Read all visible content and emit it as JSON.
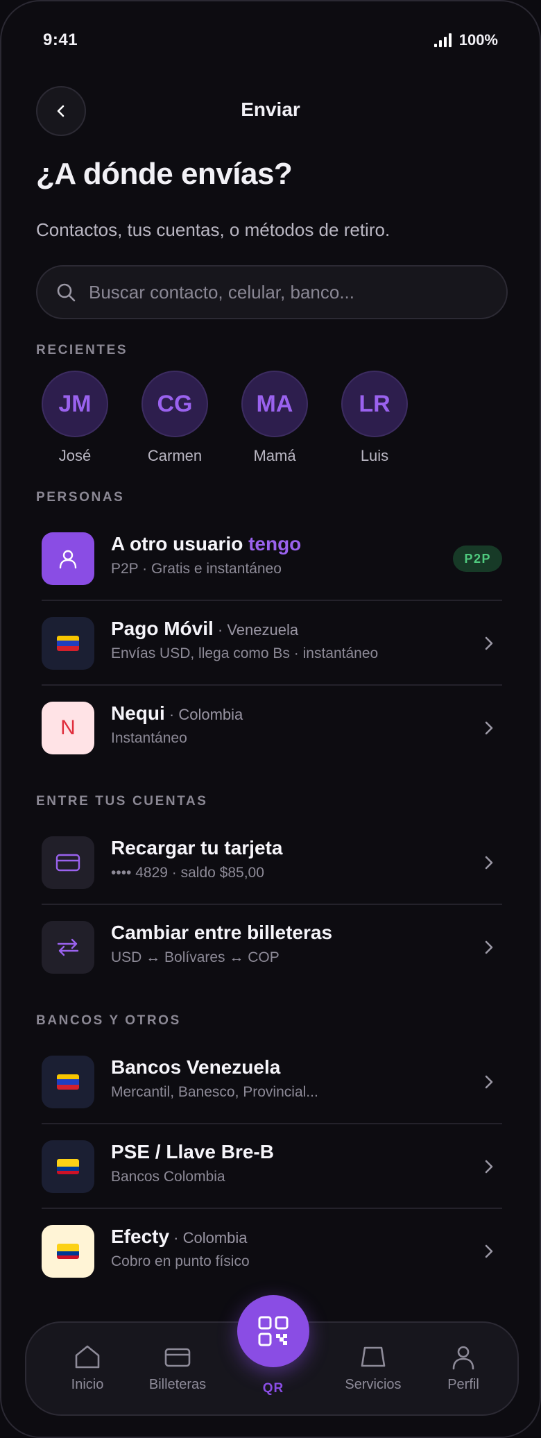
{
  "status": {
    "time": "9:41",
    "battery": "100%"
  },
  "header": {
    "title": "Enviar"
  },
  "heading": "¿A dónde envías?",
  "subheading": "Contactos, tus cuentas, o métodos de retiro.",
  "search": {
    "placeholder": "Buscar contacto, celular, banco..."
  },
  "sections": {
    "recientes": "RECIENTES",
    "personas": "PERSONAS",
    "entre_cuentas": "ENTRE TUS CUENTAS",
    "bancos": "BANCOS Y OTROS"
  },
  "recents": [
    {
      "initials": "JM",
      "name": "José"
    },
    {
      "initials": "CG",
      "name": "Carmen"
    },
    {
      "initials": "MA",
      "name": "Mamá"
    },
    {
      "initials": "LR",
      "name": "Luis"
    }
  ],
  "personas": [
    {
      "title": "A otro usuario ",
      "accent": "tengo",
      "country": "",
      "subtitle": "P2P · Gratis e instantáneo",
      "badge": "P2P"
    },
    {
      "title": "Pago Móvil",
      "country": " · Venezuela",
      "subtitle": "Envías USD, llega como Bs · instantáneo"
    },
    {
      "title": "Nequi",
      "country": " · Colombia",
      "subtitle": "Instantáneo",
      "letter": "N"
    }
  ],
  "cuentas": [
    {
      "title": "Recargar tu tarjeta",
      "subtitle": "•••• 4829 · saldo $85,00"
    },
    {
      "title": "Cambiar entre billeteras",
      "subtitle": "USD ↔ Bolívares ↔ COP"
    }
  ],
  "bancos": [
    {
      "title": "Bancos Venezuela",
      "country": "",
      "subtitle": "Mercantil, Banesco, Provincial..."
    },
    {
      "title": "PSE / Llave Bre-B",
      "country": "",
      "subtitle": "Bancos Colombia"
    },
    {
      "title": "Efecty",
      "country": " · Colombia",
      "subtitle": "Cobro en punto físico"
    }
  ],
  "tabs": {
    "inicio": "Inicio",
    "billeteras": "Billeteras",
    "qr": "QR",
    "servicios": "Servicios",
    "perfil": "Perfil"
  },
  "colors": {
    "accent": "#8a4de4",
    "background": "#0d0c11",
    "badge_green": "#4fca7e"
  }
}
